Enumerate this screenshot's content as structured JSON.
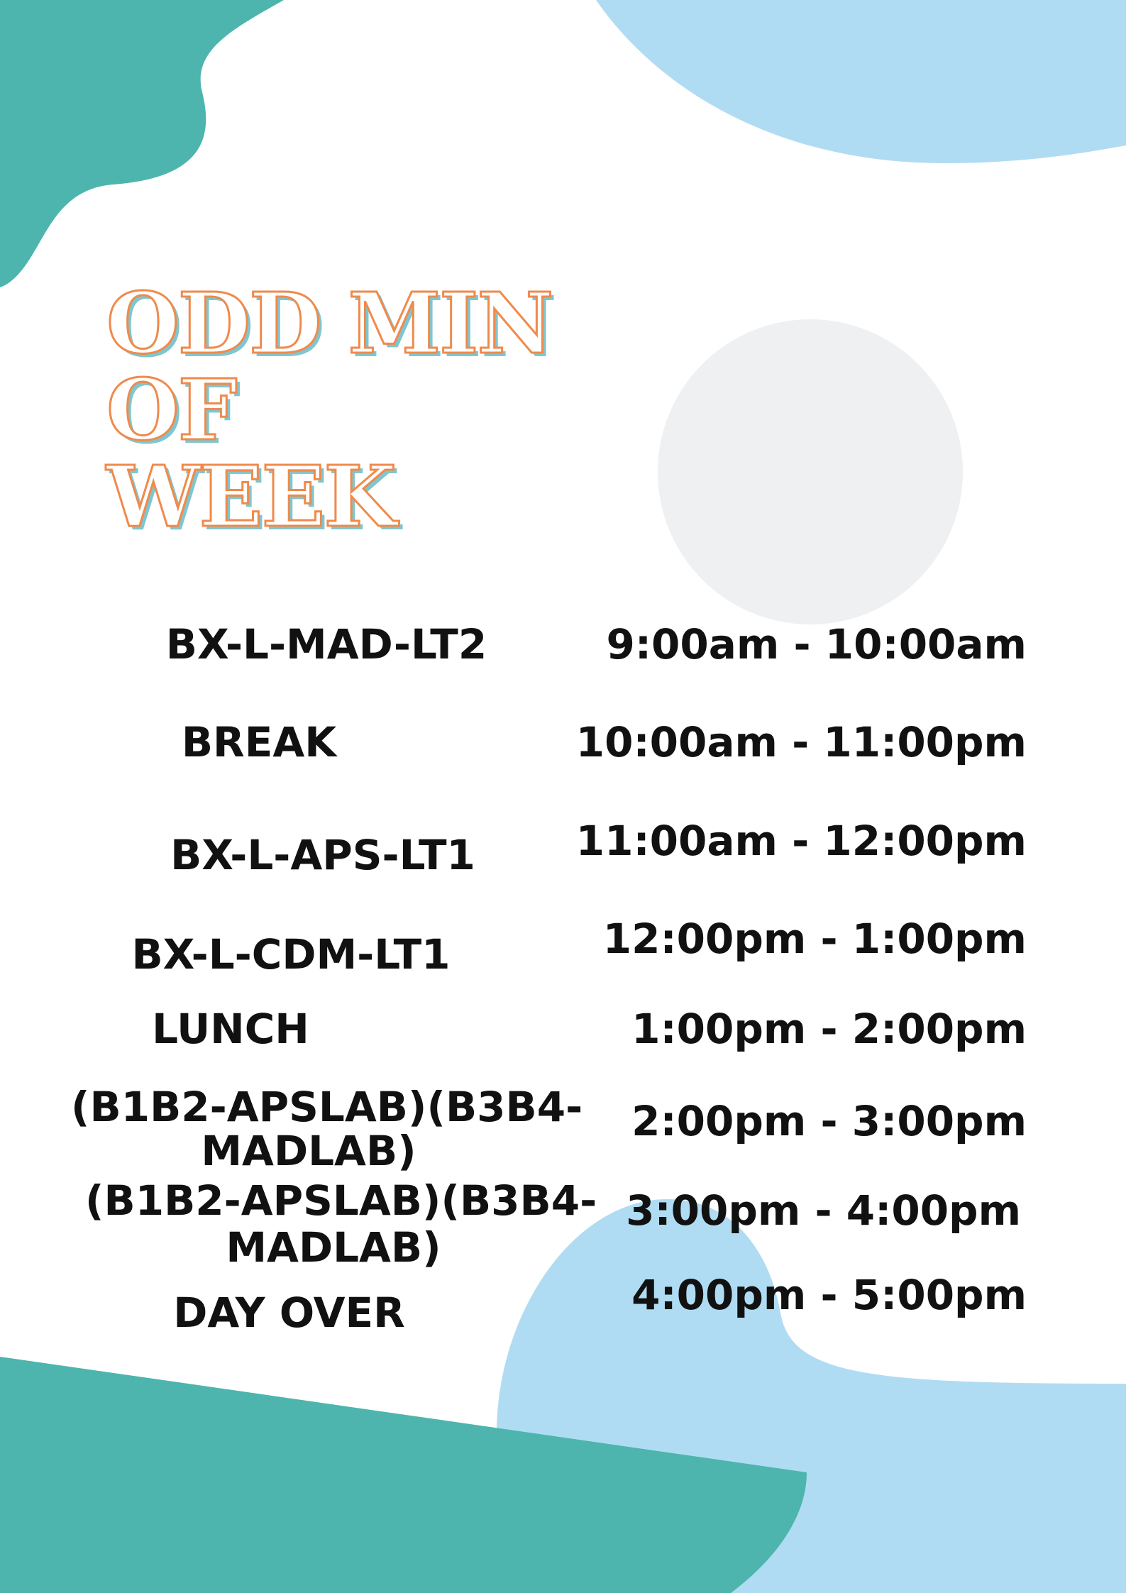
{
  "colors": {
    "teal": "#4db5ad",
    "light_blue": "#b0dcf3",
    "grey_circle": "#eef0f2",
    "title_stroke": "#f08a4b",
    "title_shadow": "#7fc6cf",
    "text": "#111111"
  },
  "title": {
    "line1": "ODD MIN OF",
    "line2": "WEEK"
  },
  "schedule": [
    {
      "label": "BX-L-MAD-LT2",
      "time": "9:00am - 10:00am"
    },
    {
      "label": "BREAK",
      "time": "10:00am - 11:00pm"
    },
    {
      "label": "BX-L-APS-LT1",
      "time": "11:00am - 12:00pm"
    },
    {
      "label": "BX-L-CDM-LT1",
      "time": "12:00pm - 1:00pm"
    },
    {
      "label": "LUNCH",
      "time": "1:00pm - 2:00pm"
    },
    {
      "label_line1": "(B1B2-APSLAB)(B3B4-",
      "label_line2": "MADLAB)",
      "time": "2:00pm - 3:00pm"
    },
    {
      "label_line1": "(B1B2-APSLAB)(B3B4-",
      "label_line2": "MADLAB)",
      "time": "3:00pm - 4:00pm"
    },
    {
      "label": "DAY OVER",
      "time": "4:00pm - 5:00pm"
    }
  ]
}
